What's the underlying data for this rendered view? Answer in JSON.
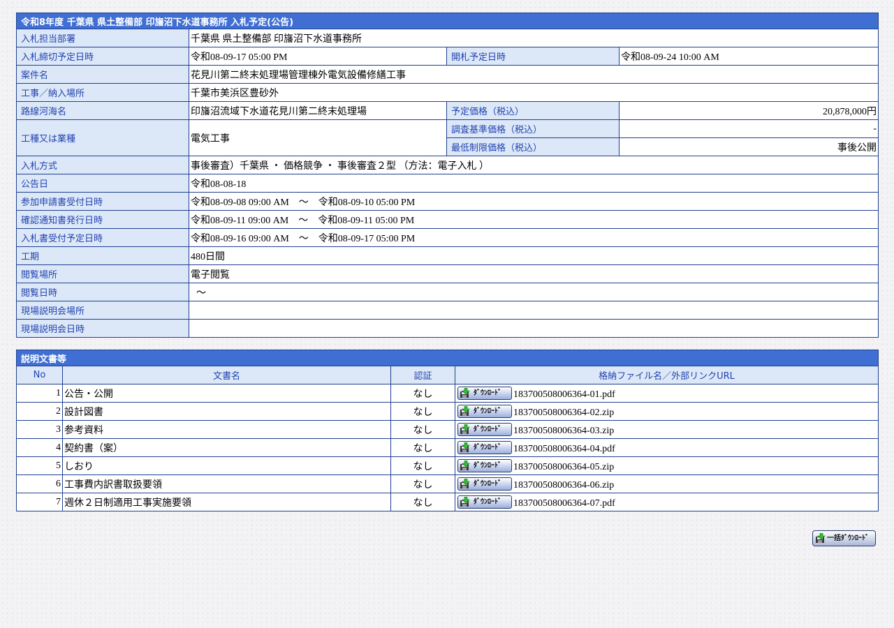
{
  "notice": {
    "title": "令和8年度 千葉県 県土整備部 印旛沼下水道事務所 入札予定(公告)",
    "rows": {
      "dept": {
        "label": "入札担当部署",
        "value": "千葉県 県土整備部 印旛沼下水道事務所"
      },
      "deadline": {
        "label": "入札締切予定日時",
        "value": "令和08-09-17 05:00 PM"
      },
      "opening": {
        "label": "開札予定日時",
        "value": "令和08-09-24 10:00 AM"
      },
      "project": {
        "label": "案件名",
        "value": "花見川第二終末処理場管理棟外電気設備修繕工事"
      },
      "location": {
        "label": "工事／納入場所",
        "value": "千葉市美浜区豊砂外"
      },
      "route": {
        "label": "路線河海名",
        "value": "印旛沼流域下水道花見川第二終末処理場"
      },
      "price": {
        "label": "予定価格（税込）",
        "value": "20,878,000円"
      },
      "category": {
        "label": "工種又は業種",
        "value": "電気工事"
      },
      "survey_price": {
        "label": "調査基準価格（税込）",
        "value": "-"
      },
      "min_price": {
        "label": "最低制限価格（税込）",
        "value": "事後公開"
      },
      "method": {
        "label": "入札方式",
        "value": "事後審査）千葉県 ・ 価格競争 ・ 事後審査２型 （方法：電子入札 ）"
      },
      "announce": {
        "label": "公告日",
        "value": "令和08-08-18"
      },
      "apply": {
        "label": "参加申請書受付日時",
        "value": "令和08-09-08 09:00 AM　～　令和08-09-10 05:00 PM"
      },
      "confirm": {
        "label": "確認通知書発行日時",
        "value": "令和08-09-11 09:00 AM　～　令和08-09-11 05:00 PM"
      },
      "bid_accept": {
        "label": "入札書受付予定日時",
        "value": "令和08-09-16 09:00 AM　～　令和08-09-17 05:00 PM"
      },
      "period": {
        "label": "工期",
        "value": "480日間"
      },
      "view_place": {
        "label": "閲覧場所",
        "value": "電子閲覧"
      },
      "view_time": {
        "label": "閲覧日時",
        "value": "～"
      },
      "site_place": {
        "label": "現場説明会場所",
        "value": ""
      },
      "site_time": {
        "label": "現場説明会日時",
        "value": ""
      }
    }
  },
  "docs": {
    "title": "説明文書等",
    "headers": {
      "no": "No",
      "name": "文書名",
      "auth": "認証",
      "file": "格納ファイル名／外部リンクURL"
    },
    "download_label": "ﾀﾞｳﾝﾛｰﾄﾞ",
    "rows": [
      {
        "no": "1",
        "name": "公告・公開",
        "auth": "なし",
        "file": "183700508006364-01.pdf"
      },
      {
        "no": "2",
        "name": "設計図書",
        "auth": "なし",
        "file": "183700508006364-02.zip"
      },
      {
        "no": "3",
        "name": "参考資料",
        "auth": "なし",
        "file": "183700508006364-03.zip"
      },
      {
        "no": "4",
        "name": "契約書（案）",
        "auth": "なし",
        "file": "183700508006364-04.pdf"
      },
      {
        "no": "5",
        "name": "しおり",
        "auth": "なし",
        "file": "183700508006364-05.zip"
      },
      {
        "no": "6",
        "name": "工事費内訳書取扱要領",
        "auth": "なし",
        "file": "183700508006364-06.zip"
      },
      {
        "no": "7",
        "name": "週休２日制適用工事実施要領",
        "auth": "なし",
        "file": "183700508006364-07.pdf"
      }
    ],
    "bulk_label": "一括ﾀﾞｳﾝﾛｰﾄﾞ"
  },
  "icons": {
    "download": "download-disk-icon"
  },
  "colors": {
    "title_bg": "#3f6fd3",
    "label_bg": "#dce8f7",
    "label_text": "#2242b0",
    "border": "#1f3f8f"
  }
}
